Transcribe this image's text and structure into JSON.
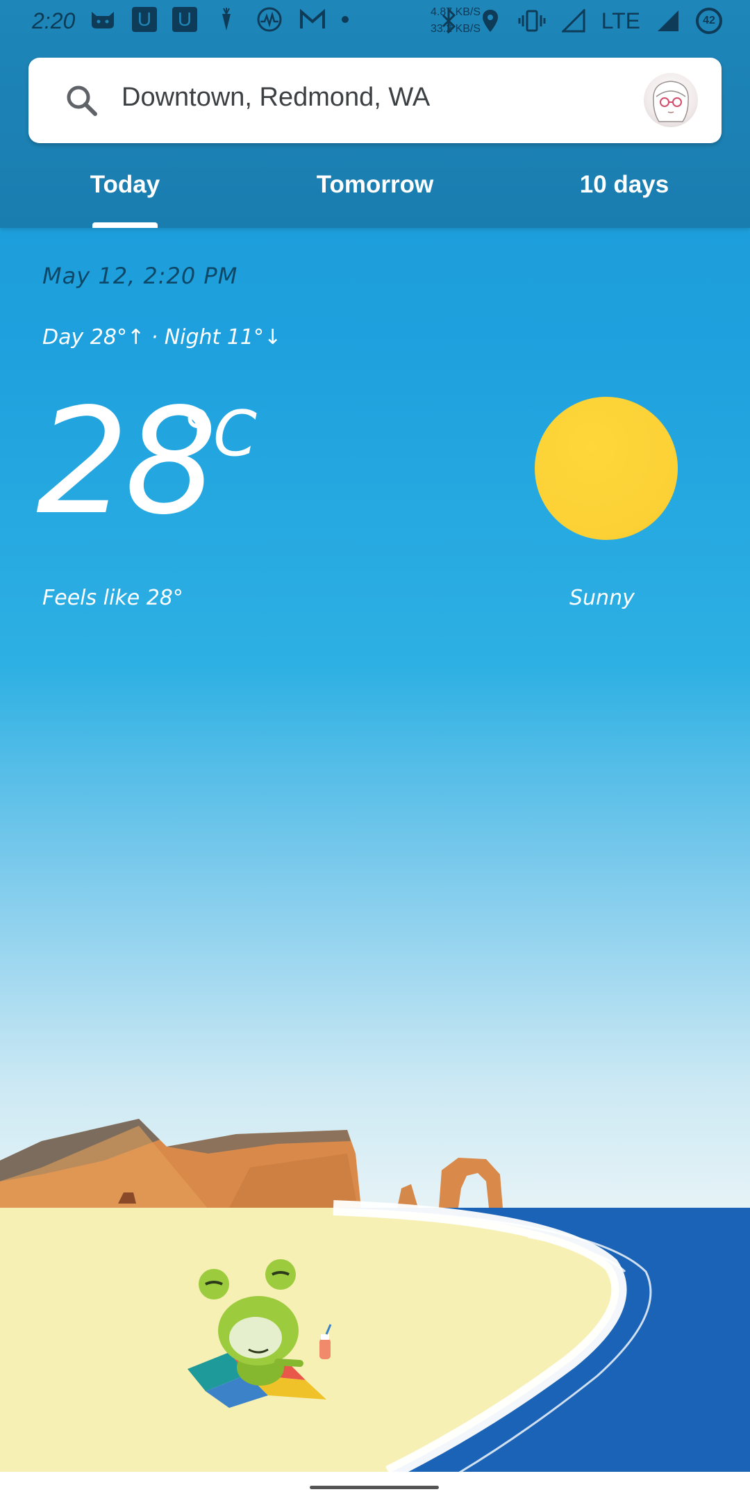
{
  "status_bar": {
    "time": "2:20",
    "net_speed_up": "4.87 KB/S",
    "net_speed_down": "33.2 KB/S",
    "network": "LTE",
    "battery": "42"
  },
  "search": {
    "location": "Downtown, Redmond, WA"
  },
  "tabs": {
    "today": "Today",
    "tomorrow": "Tomorrow",
    "ten_days": "10 days"
  },
  "weather": {
    "datetime": "May 12, 2:20 PM",
    "day_night": "Day 28°↑ · Night 11°↓",
    "temperature": "28",
    "unit": "°C",
    "feels_like": "Feels like 28°",
    "condition": "Sunny"
  },
  "colors": {
    "header": "#1e86b9",
    "sky": "#1fa1de",
    "sun": "#fbd136",
    "sand": "#f6efb0",
    "sea": "#1565c0"
  }
}
